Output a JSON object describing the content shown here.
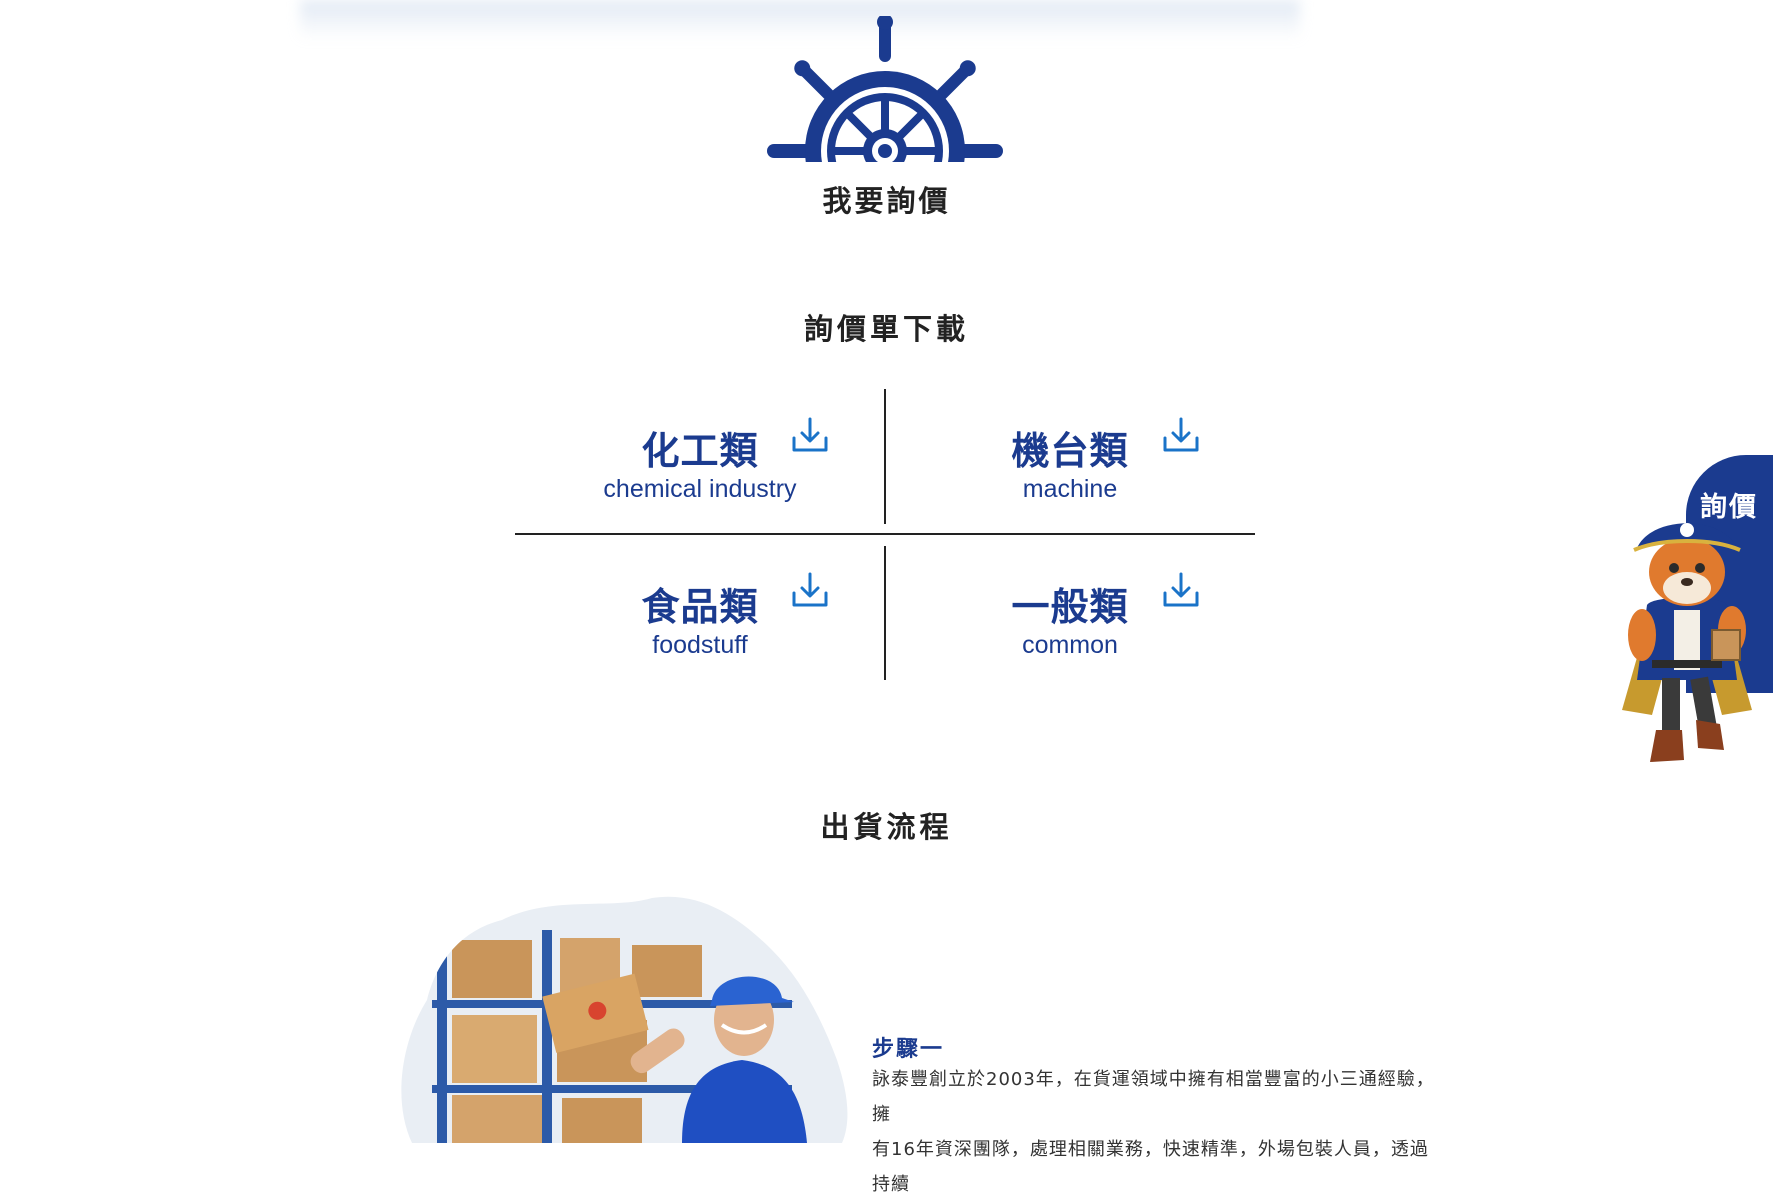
{
  "quote_cta": {
    "label": "我要詢價"
  },
  "download_section": {
    "title": "詢價單下載"
  },
  "categories": [
    {
      "zh": "化工類",
      "en": "chemical industry"
    },
    {
      "zh": "機台類",
      "en": "machine"
    },
    {
      "zh": "食品類",
      "en": "foodstuff"
    },
    {
      "zh": "一般類",
      "en": "common"
    }
  ],
  "shipping_section": {
    "title": "出貨流程"
  },
  "steps": [
    {
      "title": "步驟一",
      "text_line1": "詠泰豐創立於2003年，在貨運領域中擁有相當豐富的小三通經驗，擁",
      "text_line2": "有16年資深團隊，處理相關業務，快速精準，外場包裝人員，透過持續"
    }
  ],
  "side_tab": {
    "label": "詢價"
  },
  "colors": {
    "brand_blue": "#1b3b8f",
    "download_icon": "#1a73c8"
  }
}
